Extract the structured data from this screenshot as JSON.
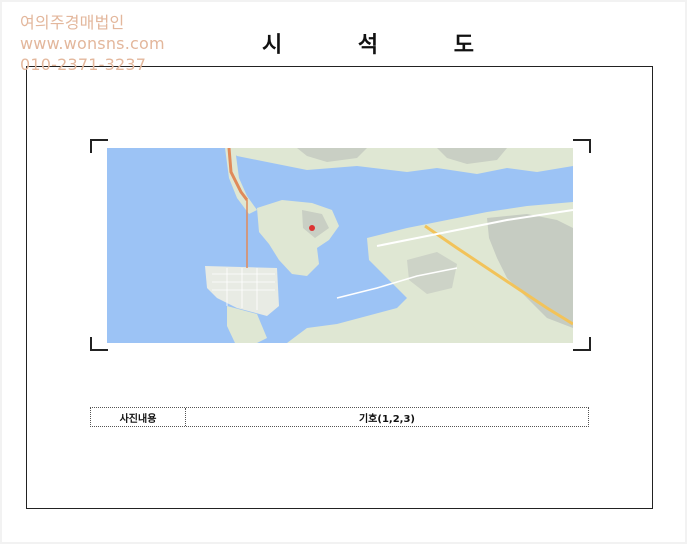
{
  "watermark": {
    "company": "여의주경매법인",
    "website": "www.wonsns.com",
    "phone": "010-2371-3237"
  },
  "document": {
    "title": "시 석 도"
  },
  "photo_caption": {
    "label": "사진내용",
    "value": "기호(1,2,3)"
  },
  "colors": {
    "watermark": "#e3b79c",
    "sea": "#9cc3f5",
    "land": "#dfe7d3",
    "terrain": "#c9cfc4",
    "road_major": "#f2c35a",
    "road_minor": "#ffffff"
  }
}
